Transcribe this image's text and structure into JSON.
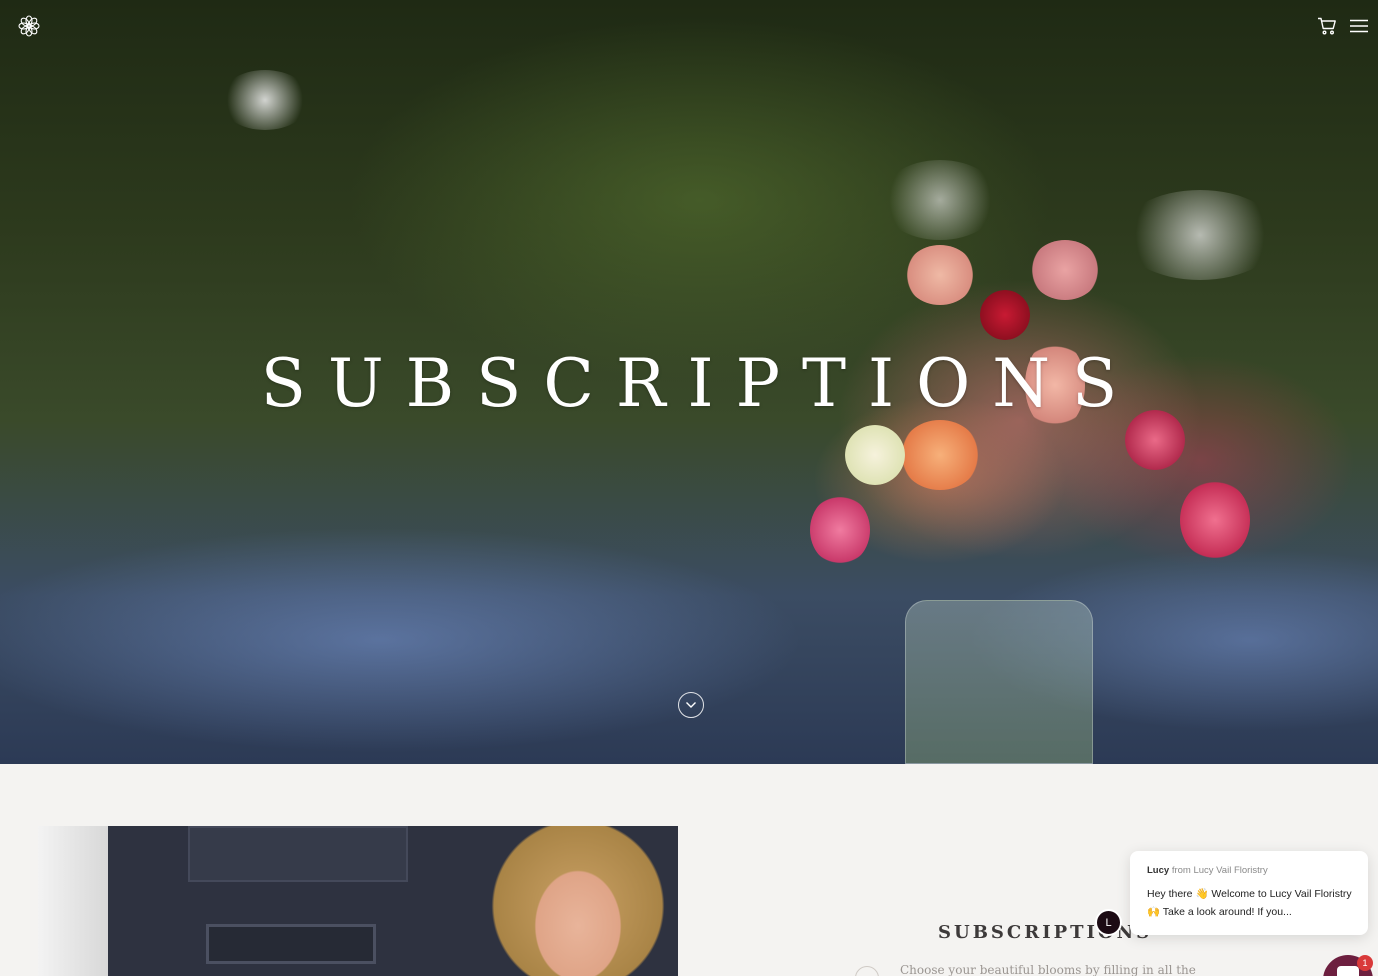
{
  "header": {
    "logo_icon": "flower-logo-icon",
    "cart_icon": "cart-icon",
    "menu_icon": "hamburger-menu-icon"
  },
  "hero": {
    "title": "SUBSCRIPTIONS",
    "scroll_icon": "chevron-down-circle-icon"
  },
  "section": {
    "heading": "SUBSCRIPTIONS",
    "text": "Choose your beautiful blooms by filling in all the"
  },
  "chat": {
    "sender_name": "Lucy",
    "sender_org": "from Lucy Vail Floristry",
    "message": "Hey there 👋 Welcome to Lucy Vail Floristry 🙌 Take a look around! If you...",
    "avatar_initial": "L",
    "unread_count": "1",
    "accent_color": "#6d1f3f"
  }
}
